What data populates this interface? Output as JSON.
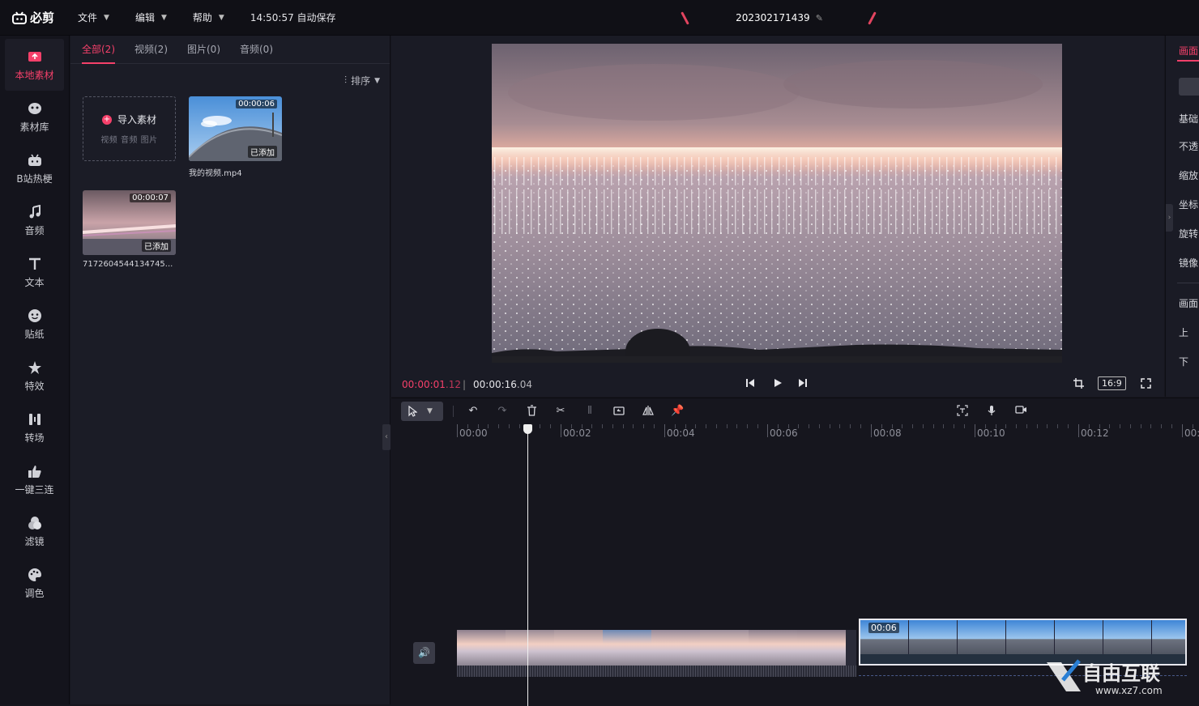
{
  "app": {
    "name": "必剪"
  },
  "menu": [
    {
      "label": "文件"
    },
    {
      "label": "编辑"
    },
    {
      "label": "帮助"
    }
  ],
  "autosave": "14:50:57 自动保存",
  "project": {
    "name": "202302171439"
  },
  "nav": [
    {
      "label": "本地素材",
      "icon": "upload-icon",
      "active": true
    },
    {
      "label": "素材库",
      "icon": "library-icon"
    },
    {
      "label": "B站热梗",
      "icon": "bilibili-tv-icon"
    },
    {
      "label": "音频",
      "icon": "music-note-icon"
    },
    {
      "label": "文本",
      "icon": "text-icon"
    },
    {
      "label": "贴纸",
      "icon": "sticker-icon"
    },
    {
      "label": "特效",
      "icon": "effects-star-icon"
    },
    {
      "label": "转场",
      "icon": "transition-icon"
    },
    {
      "label": "一键三连",
      "icon": "thumbs-up-icon"
    },
    {
      "label": "滤镜",
      "icon": "filter-icon"
    },
    {
      "label": "调色",
      "icon": "palette-icon"
    }
  ],
  "library": {
    "tabs": [
      {
        "label": "全部(2)",
        "active": true
      },
      {
        "label": "视频(2)"
      },
      {
        "label": "图片(0)"
      },
      {
        "label": "音频(0)"
      }
    ],
    "sort_label": "排序",
    "import": {
      "label": "导入素材",
      "sub": "视频 音频 图片"
    },
    "items": [
      {
        "name": "我的视频.mp4",
        "duration": "00:00:06",
        "status": "已添加"
      },
      {
        "name": "7172604544134745...",
        "duration": "00:00:07",
        "status": "已添加"
      }
    ]
  },
  "preview": {
    "current_time": "00:00:01",
    "current_frames": ".12",
    "separator": "|",
    "total_time": "00:00:16",
    "total_frames": ".04",
    "aspect_ratio": "16:9"
  },
  "right_panel": {
    "tab": "画面",
    "labels": [
      "基础",
      "不透",
      "缩放",
      "坐标",
      "旋转",
      "镜像",
      "画面",
      "上",
      "下"
    ]
  },
  "timeline": {
    "tick_labels": [
      "00:00",
      "00:02",
      "00:04",
      "00:06",
      "00:08",
      "00:10",
      "00:12",
      "00:"
    ],
    "clip2_duration": "00:06"
  },
  "colors": {
    "accent": "#f5406a",
    "background": "#16161e",
    "panel": "#1b1c26"
  },
  "watermark": "自由互联 www.xz7.com"
}
